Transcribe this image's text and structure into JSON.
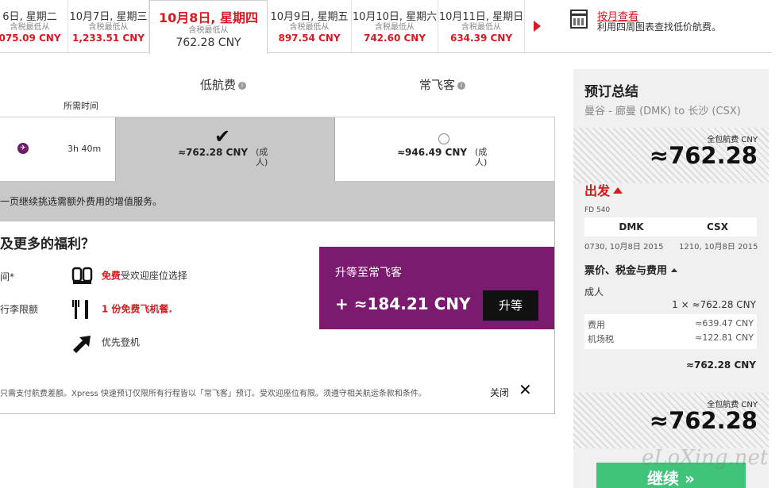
{
  "date_strip": {
    "tax_note": "含税最低从",
    "dates": [
      {
        "date": "6日, 星期二",
        "price": "075.09 CNY"
      },
      {
        "date": "10月7日, 星期三",
        "price": "1,233.51 CNY"
      },
      {
        "date": "10月8日, 星期四",
        "price": "762.28 CNY",
        "active": true
      },
      {
        "date": "10月9日, 星期五",
        "price": "897.54 CNY"
      },
      {
        "date": "10月10日, 星期六",
        "price": "742.60 CNY"
      },
      {
        "date": "10月11日, 星期日",
        "price": "634.39 CNY"
      }
    ],
    "month_view": {
      "link": "按月查看",
      "desc": "利用四周图表查找低价航费。"
    }
  },
  "fare_table": {
    "col_low": "低航费",
    "col_freq": "常飞客",
    "duration_header": "所需时间",
    "duration": "3h 40m",
    "low_fare": "≈762.28 CNY",
    "freq_fare": "≈946.49 CNY",
    "per_person": "(成人)",
    "notice": "一页继续挑选需额外费用的增值服务。"
  },
  "benefits": {
    "title": "及更多的福利？",
    "left1": "间*",
    "left2": "行李限额",
    "seat_free": "免费",
    "seat_text": "受欢迎座位选择",
    "meal_text": "1 份免费飞机餐.",
    "boarding": "优先登机",
    "footnote": "只需支付航费差额。Xpress 快速预订仅限所有行程皆以「常飞客」预订。受欢迎座位有限。须遵守相关航运条款和条件。",
    "close": "关闭",
    "upgrade_title": "升等至常飞客",
    "upgrade_price": "+ ≈184.21 CNY",
    "upgrade_button": "升等"
  },
  "summary": {
    "title": "预订总结",
    "route": "曼谷 - 廊曼 (DMK) to 长沙 (CSX)",
    "total_label": "全包航费 CNY",
    "total": "≈762.28",
    "departure": "出发",
    "flight_no": "FD 540",
    "from": "DMK",
    "to": "CSX",
    "dep_time": "0730, 10月8日 2015",
    "arr_time": "1210, 10月8日 2015",
    "fees_title": "票价、税金与费用",
    "adult": "成人",
    "adult_line": "1 × ≈762.28 CNY",
    "fee_label": "费用",
    "fee_value": "≈639.47 CNY",
    "tax_label": "机场税",
    "tax_value": "≈122.81 CNY",
    "subtotal": "≈762.28 CNY",
    "continue": "继续 »"
  },
  "watermark": "eLoXing.net",
  "colors": {
    "brand_red": "#d71920",
    "purple": "#7a1b6f",
    "continue_green": "#3fc47a"
  }
}
